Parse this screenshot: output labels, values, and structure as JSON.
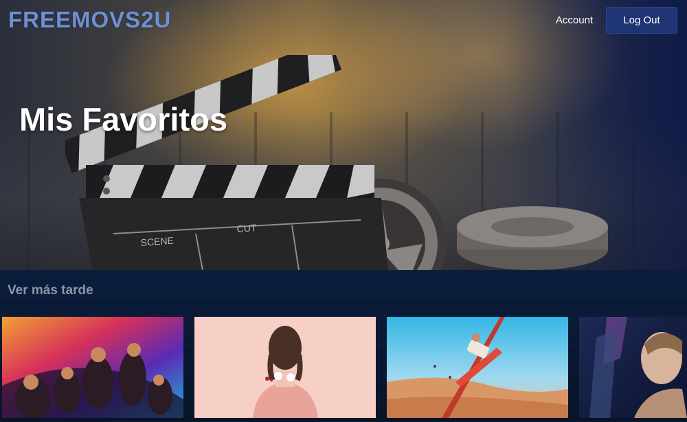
{
  "header": {
    "logo": "FREEMOVS2U",
    "account_label": "Account",
    "logout_label": "Log Out"
  },
  "hero": {
    "title": "Mis Favoritos",
    "clapper_text": {
      "scene": "SCENE",
      "cut": "CUT"
    }
  },
  "watch_later": {
    "title": "Ver más tarde",
    "movies": [
      {
        "label": "movie-poster-1"
      },
      {
        "label": "movie-poster-2"
      },
      {
        "label": "movie-poster-3"
      },
      {
        "label": "movie-poster-4"
      }
    ]
  },
  "colors": {
    "logo": "#6e8fd8",
    "logout_button": "#1f3472",
    "section_bg": "#0b1d3c",
    "section_title": "#8d96a6"
  }
}
